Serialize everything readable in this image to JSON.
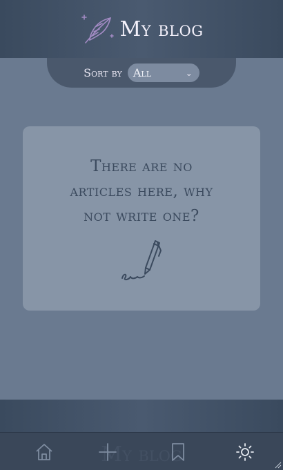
{
  "header": {
    "title": "My blog",
    "logo_icon": "feather-icon"
  },
  "sortbar": {
    "label": "Sort by",
    "selected": "All"
  },
  "empty_state": {
    "line1": "There are no",
    "line2": "articles here, why",
    "line3": "not write one?",
    "icon": "pen-writing-icon"
  },
  "navbar": {
    "ghost_title": "My blog",
    "items": [
      {
        "name": "home",
        "icon": "home-icon"
      },
      {
        "name": "add",
        "icon": "plus-icon"
      },
      {
        "name": "bookmarks",
        "icon": "bookmark-icon"
      },
      {
        "name": "theme",
        "icon": "sun-icon"
      }
    ]
  },
  "colors": {
    "background": "#6a7a90",
    "header": "#3a4a5e",
    "card": "#8795a7",
    "text_dark": "#3b4a5e",
    "accent_purple": "#a38bc4"
  }
}
